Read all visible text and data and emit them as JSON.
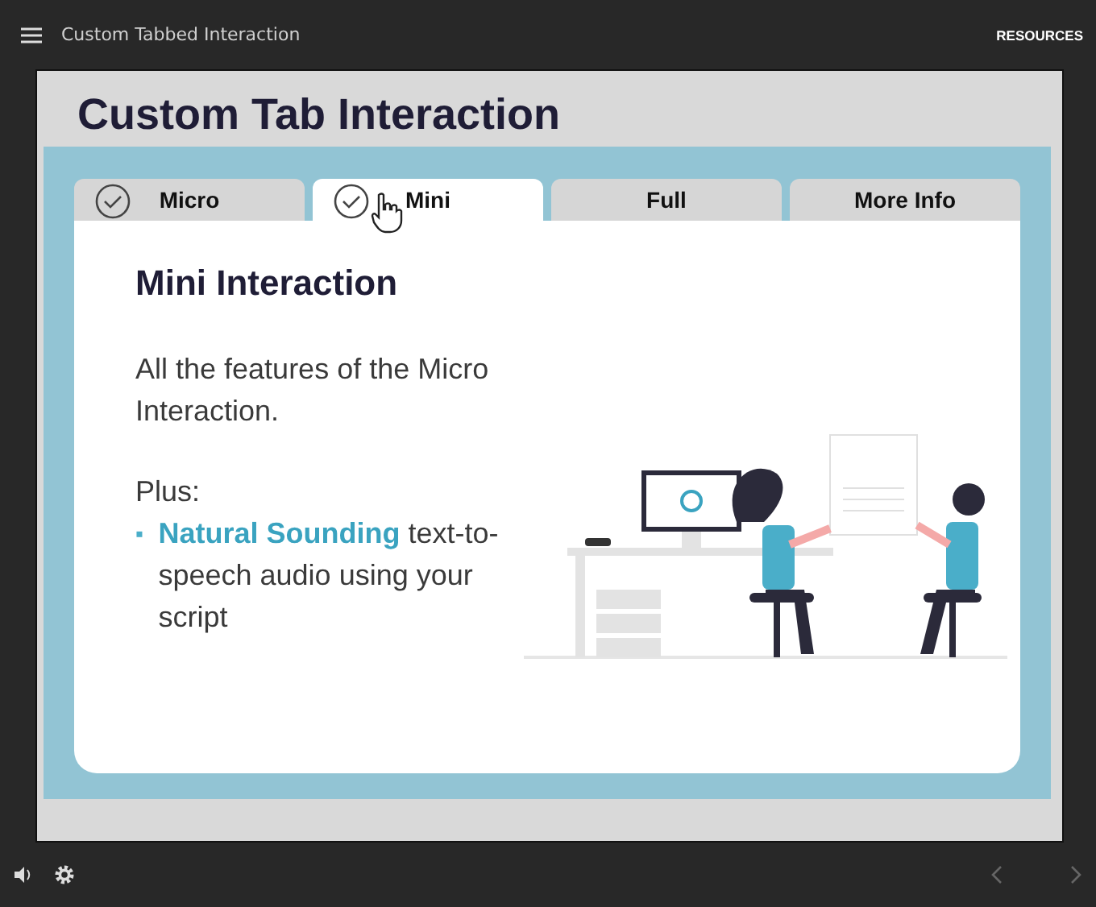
{
  "player": {
    "title": "Custom Tabbed Interaction",
    "resources": "RESOURCES"
  },
  "slide": {
    "title": "Custom Tab Interaction",
    "tabs": [
      {
        "label": "Micro",
        "checked": true,
        "selected": false
      },
      {
        "label": "Mini",
        "checked": true,
        "selected": true
      },
      {
        "label": "Full",
        "checked": false,
        "selected": false
      },
      {
        "label": "More Info",
        "checked": false,
        "selected": false
      }
    ],
    "heading": "Mini Interaction",
    "paragraph": "All the features of the Micro Interaction.",
    "plus": "Plus:",
    "bullets": [
      {
        "marker": "▪",
        "text": "**Natural Sounding** text-to-speech audio using your script"
      }
    ]
  }
}
